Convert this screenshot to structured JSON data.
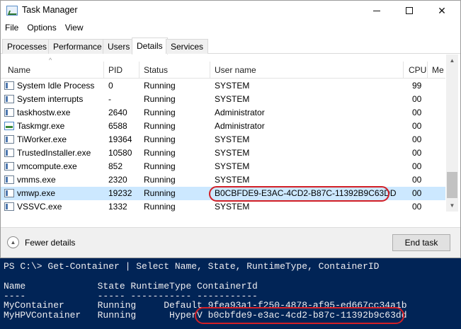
{
  "window": {
    "title": "Task Manager",
    "controls": {
      "minimize_icon": "minimize-icon",
      "maximize_icon": "maximize-icon",
      "close_glyph": "✕"
    }
  },
  "menu": [
    "File",
    "Options",
    "View"
  ],
  "tabs": [
    {
      "label": "Processes",
      "active": false
    },
    {
      "label": "Performance",
      "active": false
    },
    {
      "label": "Users",
      "active": false
    },
    {
      "label": "Details",
      "active": true
    },
    {
      "label": "Services",
      "active": false
    }
  ],
  "columns": {
    "name": "Name",
    "pid": "PID",
    "status": "Status",
    "user": "User name",
    "cpu": "CPU",
    "mem": "Me"
  },
  "processes": [
    {
      "name": "System Idle Process",
      "pid": "0",
      "status": "Running",
      "user": "SYSTEM",
      "cpu": "99",
      "selected": false,
      "icon": "system-process-icon"
    },
    {
      "name": "System interrupts",
      "pid": "-",
      "status": "Running",
      "user": "SYSTEM",
      "cpu": "00",
      "selected": false,
      "icon": "system-process-icon"
    },
    {
      "name": "taskhostw.exe",
      "pid": "2640",
      "status": "Running",
      "user": "Administrator",
      "cpu": "00",
      "selected": false,
      "icon": "process-icon"
    },
    {
      "name": "Taskmgr.exe",
      "pid": "6588",
      "status": "Running",
      "user": "Administrator",
      "cpu": "00",
      "selected": false,
      "icon": "task-manager-icon"
    },
    {
      "name": "TiWorker.exe",
      "pid": "19364",
      "status": "Running",
      "user": "SYSTEM",
      "cpu": "00",
      "selected": false,
      "icon": "process-icon"
    },
    {
      "name": "TrustedInstaller.exe",
      "pid": "10580",
      "status": "Running",
      "user": "SYSTEM",
      "cpu": "00",
      "selected": false,
      "icon": "process-icon"
    },
    {
      "name": "vmcompute.exe",
      "pid": "852",
      "status": "Running",
      "user": "SYSTEM",
      "cpu": "00",
      "selected": false,
      "icon": "process-icon"
    },
    {
      "name": "vmms.exe",
      "pid": "2320",
      "status": "Running",
      "user": "SYSTEM",
      "cpu": "00",
      "selected": false,
      "icon": "process-icon"
    },
    {
      "name": "vmwp.exe",
      "pid": "19232",
      "status": "Running",
      "user": "B0CBFDE9-E3AC-4CD2-B87C-11392B9C63DD",
      "cpu": "00",
      "selected": true,
      "icon": "process-icon"
    },
    {
      "name": "VSSVC.exe",
      "pid": "1332",
      "status": "Running",
      "user": "SYSTEM",
      "cpu": "00",
      "selected": false,
      "icon": "process-icon"
    }
  ],
  "footer": {
    "fewer_details": "Fewer details",
    "end_task": "End task"
  },
  "powershell": {
    "lines": [
      "PS C:\\> Get-Container | Select Name, State, RuntimeType, ContainerID",
      "",
      "Name             State RuntimeType ContainerId",
      "----             ----- ----------- -----------",
      "MyContainer      Running     Default 9fea93a1-f250-4878-af95-ed667cc34a1b",
      "MyHPVContainer   Running      HyperV b0cbfde9-e3ac-4cd2-b87c-11392b9c63dd"
    ]
  },
  "colors": {
    "highlight": "#d21f26",
    "selection": "#cce8ff",
    "powershell_bg": "#012456"
  }
}
